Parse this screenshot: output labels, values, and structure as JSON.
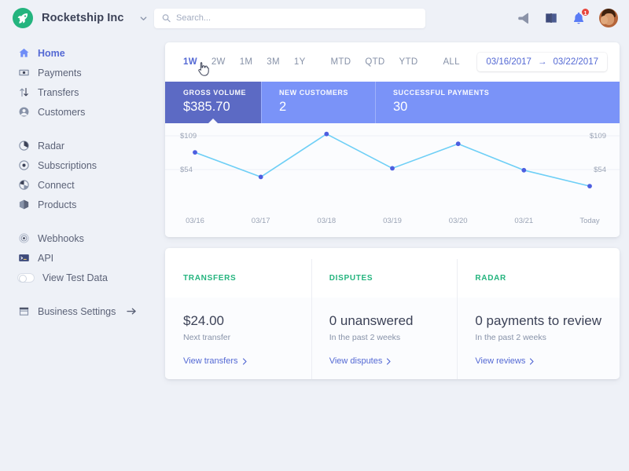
{
  "brand": {
    "name": "Rocketship Inc",
    "logo_icon": "rocket-icon",
    "caret_icon": "chevron-down-icon"
  },
  "search": {
    "placeholder": "Search...",
    "value": "",
    "icon": "search-icon"
  },
  "topbar_icons": [
    {
      "name": "megaphone-icon"
    },
    {
      "name": "book-icon"
    },
    {
      "name": "bell-icon",
      "badge": "1"
    },
    {
      "name": "avatar"
    }
  ],
  "sidebar": {
    "groups": [
      {
        "items": [
          {
            "label": "Home",
            "icon": "home-icon",
            "active": true
          },
          {
            "label": "Payments",
            "icon": "card-icon",
            "active": false
          },
          {
            "label": "Transfers",
            "icon": "transfers-icon",
            "active": false
          },
          {
            "label": "Customers",
            "icon": "customers-icon",
            "active": false
          }
        ]
      },
      {
        "items": [
          {
            "label": "Radar",
            "icon": "radar-icon",
            "active": false
          },
          {
            "label": "Subscriptions",
            "icon": "subscriptions-icon",
            "active": false
          },
          {
            "label": "Connect",
            "icon": "connect-icon",
            "active": false
          },
          {
            "label": "Products",
            "icon": "products-icon",
            "active": false
          }
        ]
      },
      {
        "items": [
          {
            "label": "Webhooks",
            "icon": "webhooks-icon",
            "active": false
          },
          {
            "label": "API",
            "icon": "api-icon",
            "active": false
          },
          {
            "label": "View Test Data",
            "icon": "toggle-switch",
            "active": false,
            "toggle": "off"
          }
        ]
      },
      {
        "items": [
          {
            "label": "Business Settings",
            "icon": "store-icon",
            "active": false,
            "trailing_icon": "arrow-right-icon"
          }
        ]
      }
    ]
  },
  "range_tabs": [
    {
      "label": "1W",
      "active": true,
      "hovered": false
    },
    {
      "label": "2W",
      "active": false,
      "hovered": true
    },
    {
      "label": "1M",
      "active": false,
      "hovered": false
    },
    {
      "label": "3M",
      "active": false,
      "hovered": false
    },
    {
      "label": "1Y",
      "active": false,
      "hovered": false
    },
    {
      "label": "MTD",
      "active": false,
      "hovered": false
    },
    {
      "label": "QTD",
      "active": false,
      "hovered": false
    },
    {
      "label": "YTD",
      "active": false,
      "hovered": false
    },
    {
      "label": "ALL",
      "active": false,
      "hovered": false
    }
  ],
  "date_range": {
    "start": "03/16/2017",
    "separator": "→",
    "end": "03/22/2017"
  },
  "metrics": [
    {
      "label": "GROSS VOLUME",
      "value": "$385.70",
      "active": true
    },
    {
      "label": "NEW CUSTOMERS",
      "value": "2",
      "active": false
    },
    {
      "label": "SUCCESSFUL PAYMENTS",
      "value": "30",
      "active": false
    }
  ],
  "chart_data": {
    "type": "line",
    "title": "Gross Volume",
    "xlabel": "",
    "ylabel": "",
    "x": [
      "03/16",
      "03/17",
      "03/18",
      "03/19",
      "03/20",
      "03/21",
      "Today"
    ],
    "categories": [
      "03/16",
      "03/17",
      "03/18",
      "03/19",
      "03/20",
      "03/21",
      "Today"
    ],
    "series": [
      {
        "name": "Gross Volume",
        "values": [
          82,
          42,
          112,
          56,
          96,
          53,
          27
        ]
      }
    ],
    "values": [
      82,
      42,
      112,
      56,
      96,
      53,
      27
    ],
    "ytick_labels": [
      "$109",
      "$54"
    ],
    "ytick_values": [
      109,
      54
    ],
    "ylim": [
      0,
      120
    ],
    "grid": true,
    "legend": false,
    "line_color": "#6ecff6",
    "point_color": "#4d5ee0",
    "axis_label_color": "#9aa3b5"
  },
  "cards": [
    {
      "heading": "TRANSFERS",
      "value": "$24.00",
      "subtitle": "Next transfer",
      "link": "View transfers",
      "link_icon": "chevron-right-icon"
    },
    {
      "heading": "DISPUTES",
      "value": "0 unanswered",
      "subtitle": "In the past 2 weeks",
      "link": "View disputes",
      "link_icon": "chevron-right-icon"
    },
    {
      "heading": "RADAR",
      "value": "0 payments to review",
      "subtitle": "In the past 2 weeks",
      "link": "View reviews",
      "link_icon": "chevron-right-icon"
    }
  ],
  "colors": {
    "accent_purple": "#5469d4",
    "metric_active": "#5c6ac4",
    "metric_inactive": "#7a93f8",
    "brand_green": "#24b47e",
    "page_bg": "#eef1f7",
    "badge_red": "#e8453c"
  }
}
